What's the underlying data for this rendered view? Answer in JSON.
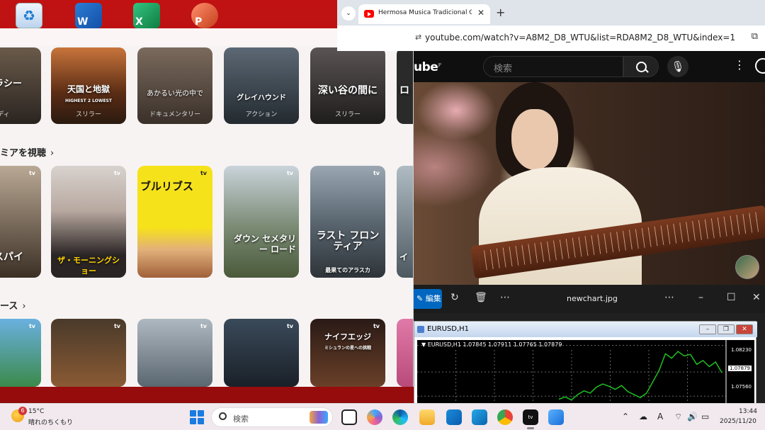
{
  "tv": {
    "row1": [
      {
        "title": "ミラシー",
        "genre": "ディ"
      },
      {
        "title": "天国と地獄",
        "subtitle": "HIGHEST 2 LOWEST",
        "genre": "スリラー"
      },
      {
        "title": "あかるい光の中で",
        "genre": "ドキュメンタリー"
      },
      {
        "title": "グレイハウンド",
        "genre": "アクション"
      },
      {
        "title": "深い谷の間に",
        "genre": "スリラー"
      },
      {
        "title": "ロ",
        "genre": ""
      }
    ],
    "section2": "ミアを視聴",
    "row2": [
      {
        "title": "のスパイ",
        "badge": "tv"
      },
      {
        "title": "ザ・モーニングショー",
        "badge": "tv"
      },
      {
        "title": "ブルリブス",
        "badge": "tv"
      },
      {
        "title": "ダウン セメタリー ロード",
        "badge": "tv"
      },
      {
        "title": "ラスト フロンティア",
        "subtitle": "最果てのアラスカ",
        "badge": "tv"
      },
      {
        "title": "イ",
        "badge": ""
      }
    ],
    "section3": "ース",
    "row3": [
      {
        "title": "",
        "badge": "tv"
      },
      {
        "title": "",
        "badge": "tv"
      },
      {
        "title": "",
        "badge": "tv"
      },
      {
        "title": "",
        "badge": "tv"
      },
      {
        "title": "ナイフエッジ",
        "subtitle": "ミシュランの星への挑戦",
        "badge": "tv"
      },
      {
        "title": "",
        "badge": ""
      }
    ]
  },
  "chrome": {
    "tab_title": "Hermosa Musica Tradicional Ch",
    "url": "youtube.com/watch?v=A8M2_D8_WTU&list=RDA8M2_D8_WTU&index=1"
  },
  "youtube": {
    "logo": "ube",
    "logo_region": "JP",
    "search_placeholder": "検索"
  },
  "photos": {
    "edit_label": "編集",
    "filename": "newchart.jpg"
  },
  "chart": {
    "window_title": "EURUSD,H1",
    "info": "▼ EURUSD,H1  1.07845 1.07911 1.07765 1.07879",
    "prices": [
      "1.08230",
      "1.07879",
      "1.07560"
    ]
  },
  "chart_data": {
    "type": "line",
    "title": "EURUSD,H1",
    "ylim": [
      1.0745,
      1.083
    ],
    "y_ticks": [
      1.0823,
      1.07879,
      1.0756
    ],
    "series": [
      {
        "name": "EURUSD",
        "values": [
          1.0752,
          1.0755,
          1.0751,
          1.0758,
          1.0763,
          1.076,
          1.0768,
          1.0772,
          1.0769,
          1.0765,
          1.077,
          1.0762,
          1.0758,
          1.0754,
          1.076,
          1.0775,
          1.079,
          1.0812,
          1.0806,
          1.0815,
          1.0809,
          1.0811,
          1.0798,
          1.0803,
          1.0795,
          1.0801,
          1.0787
        ]
      }
    ],
    "grid": true
  },
  "taskbar": {
    "weather_badge": "6",
    "temperature": "15°C",
    "weather_desc": "晴れのちくもり",
    "search_text": "検索",
    "time": "13:44",
    "date": "2025/11/20"
  },
  "colors": {
    "desktop": "#b00d0d",
    "accent": "#0067c0",
    "chart_line": "#1fbf1f"
  }
}
